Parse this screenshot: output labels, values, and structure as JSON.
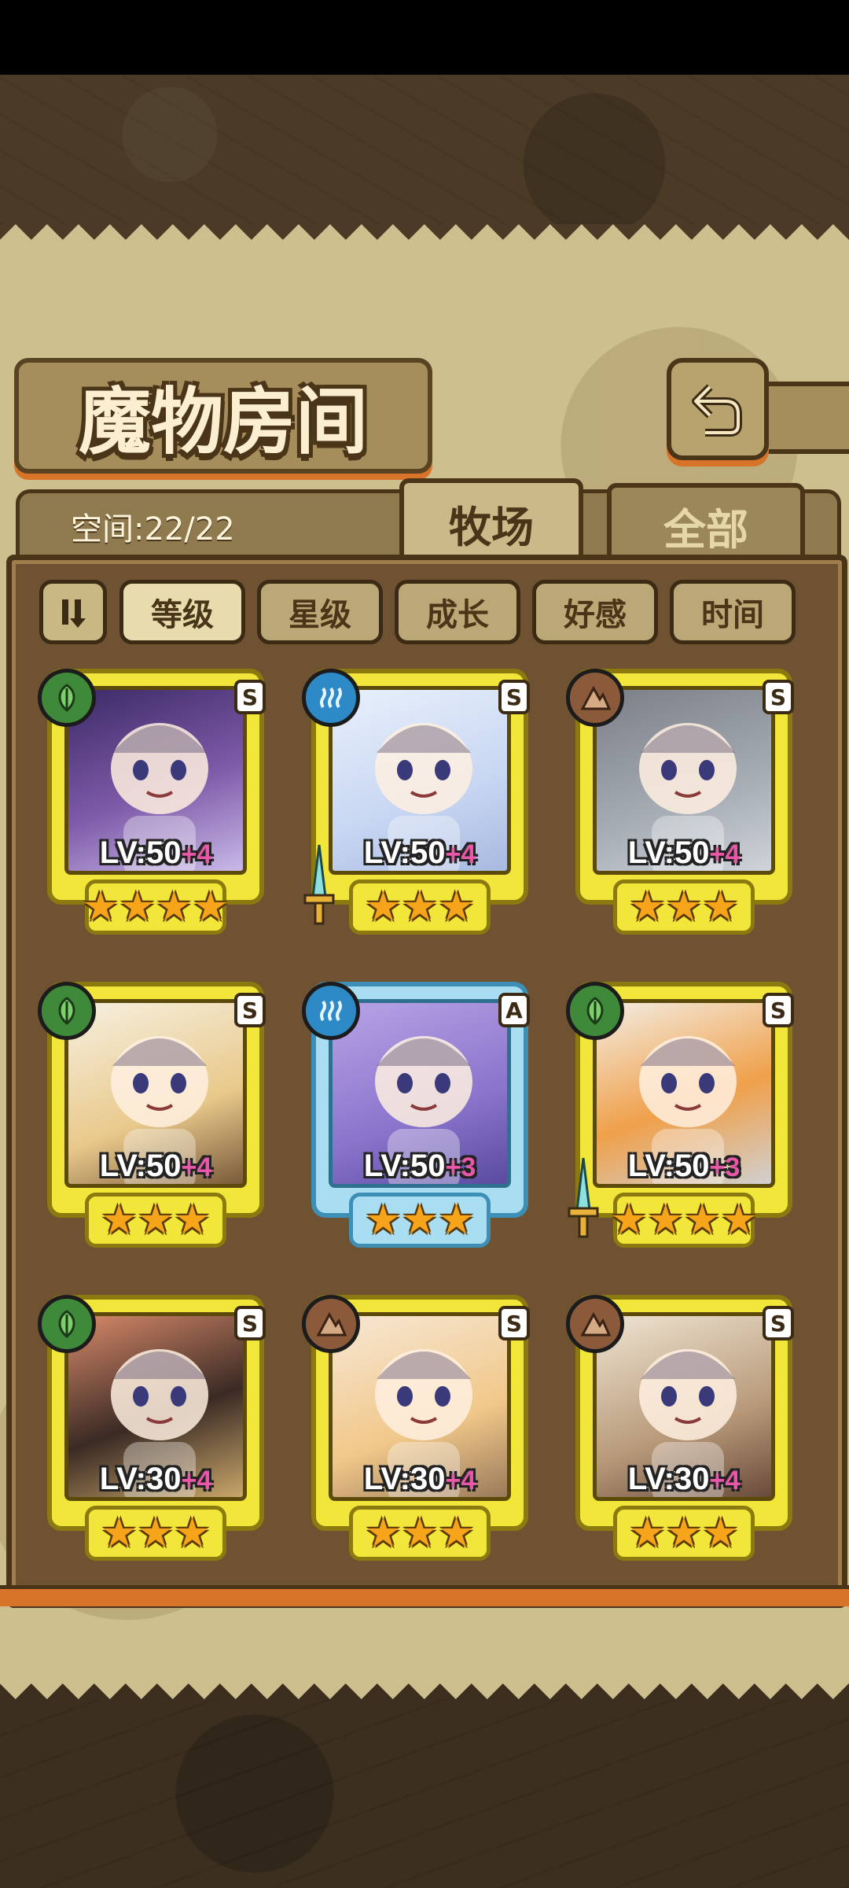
{
  "title": "魔物房间",
  "space_label": "空间:22/22",
  "tabs": [
    {
      "label": "牧场",
      "active": true
    },
    {
      "label": "全部",
      "active": false
    }
  ],
  "sort_toggle_label": "⇂⇃",
  "filters": [
    {
      "label": "等级",
      "selected": true
    },
    {
      "label": "星级",
      "selected": false
    },
    {
      "label": "成长",
      "selected": false
    },
    {
      "label": "好感",
      "selected": false
    },
    {
      "label": "时间",
      "selected": false
    }
  ],
  "cards": [
    {
      "element": "grass",
      "rank": "S",
      "level": "LV:50",
      "plus": "+4",
      "stars": "★★★★",
      "frame": "gold",
      "weapon": false
    },
    {
      "element": "water",
      "rank": "S",
      "level": "LV:50",
      "plus": "+4",
      "stars": "★★★",
      "frame": "gold",
      "weapon": true
    },
    {
      "element": "earth",
      "rank": "S",
      "level": "LV:50",
      "plus": "+4",
      "stars": "★★★",
      "frame": "gold",
      "weapon": false
    },
    {
      "element": "grass",
      "rank": "S",
      "level": "LV:50",
      "plus": "+4",
      "stars": "★★★",
      "frame": "gold",
      "weapon": false
    },
    {
      "element": "water",
      "rank": "A",
      "level": "LV:50",
      "plus": "+3",
      "stars": "★★★",
      "frame": "blue",
      "weapon": false
    },
    {
      "element": "grass",
      "rank": "S",
      "level": "LV:50",
      "plus": "+3",
      "stars": "★★★★",
      "frame": "gold",
      "weapon": true
    },
    {
      "element": "grass",
      "rank": "S",
      "level": "LV:30",
      "plus": "+4",
      "stars": "★★★",
      "frame": "gold",
      "weapon": false
    },
    {
      "element": "earth",
      "rank": "S",
      "level": "LV:30",
      "plus": "+4",
      "stars": "★★★",
      "frame": "gold",
      "weapon": false
    },
    {
      "element": "earth",
      "rank": "S",
      "level": "LV:30",
      "plus": "+4",
      "stars": "★★★",
      "frame": "gold",
      "weapon": false
    }
  ],
  "colors": {
    "parchment": "#cdbf8e",
    "panel": "#6e5232",
    "card_gold": "#f2e63a",
    "card_blue": "#a9def2",
    "plus_pink": "#e858a8",
    "accent_orange": "#d8742a"
  }
}
